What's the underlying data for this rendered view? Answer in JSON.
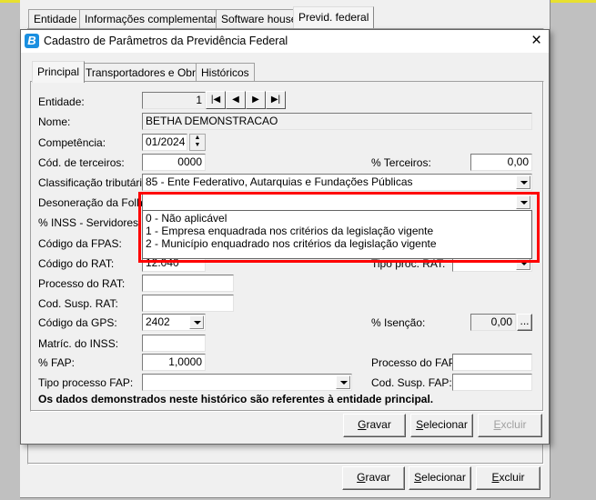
{
  "outer_tabs": [
    "Entidade",
    "Informações complementares",
    "Software house",
    "Previd. federal"
  ],
  "dialog": {
    "title": "Cadastro de Parâmetros da Previdência Federal",
    "icon": "betha-logo",
    "close": "×"
  },
  "inner_tabs": [
    "Principal",
    "Transportadores e Obras",
    "Históricos"
  ],
  "form": {
    "entidade": {
      "label": "Entidade:",
      "value": "1"
    },
    "nome": {
      "label": "Nome:",
      "value": "BETHA DEMONSTRACAO"
    },
    "competencia": {
      "label": "Competência:",
      "value": "01/2024"
    },
    "cod_terceiros": {
      "label": "Cód. de terceiros:",
      "value": "0000"
    },
    "pct_terceiros": {
      "label": "% Terceiros:",
      "value": "0,00"
    },
    "classificacao": {
      "label": "Classificação tributária:",
      "value": "85 - Ente Federativo, Autarquias e Fundações Públicas"
    },
    "desoneracao": {
      "label": "Desoneração da Folha:",
      "value": "",
      "options": [
        "0 - Não aplicável",
        "1 - Empresa enquadrada nos critérios da legislação vigente",
        "2 - Município enquadrado nos critérios da legislação vigente"
      ]
    },
    "inss_servidores": {
      "label": "% INSS - Servidores:"
    },
    "fpas": {
      "label": "Código da FPAS:"
    },
    "rat": {
      "label": "Código do RAT:",
      "value": "12.040"
    },
    "tipo_proc_rat": {
      "label": "Tipo proc. RAT:"
    },
    "processo_rat": {
      "label": "Processo do RAT:",
      "value": ""
    },
    "cod_susp_rat": {
      "label": "Cod. Susp. RAT:",
      "value": ""
    },
    "gps": {
      "label": "Código da GPS:",
      "value": "2402"
    },
    "isencao": {
      "label": "% Isenção:",
      "value": "0,00",
      "button": "..."
    },
    "matric_inss": {
      "label": "Matríc. do INSS:",
      "value": ""
    },
    "fap": {
      "label": "% FAP:",
      "value": "1,0000"
    },
    "processo_fap": {
      "label": "Processo do FAP:",
      "value": ""
    },
    "tipo_processo_fap": {
      "label": "Tipo processo FAP:",
      "value": ""
    },
    "cod_susp_fap": {
      "label": "Cod. Susp. FAP:",
      "value": ""
    },
    "note": "Os dados demonstrados neste histórico são referentes à entidade principal."
  },
  "dialog_buttons": {
    "gravar": "Gravar",
    "selecionar": "Selecionar",
    "excluir": "Excluir"
  },
  "outer_buttons": {
    "gravar": "Gravar",
    "selecionar": "Selecionar",
    "excluir": "Excluir"
  },
  "colors": {
    "highlight": "#ff0000",
    "logo": "#1a8fe0",
    "yellow": "#e8e030"
  }
}
